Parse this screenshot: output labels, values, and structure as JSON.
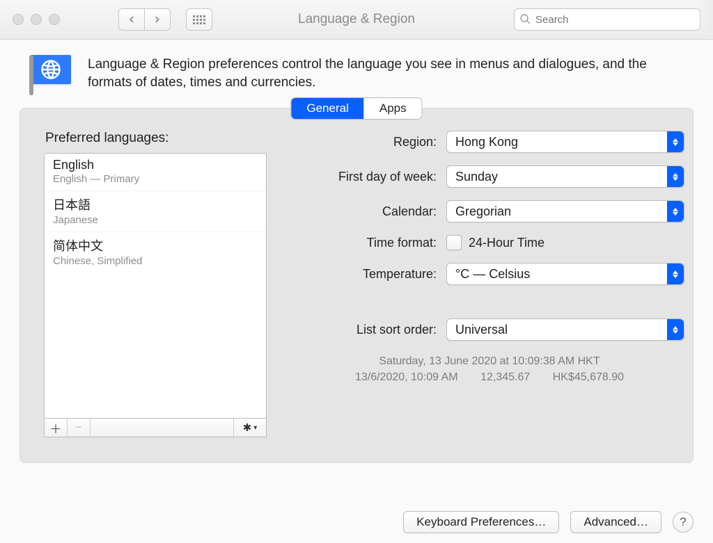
{
  "window": {
    "title": "Language & Region"
  },
  "toolbar": {
    "search_placeholder": "Search"
  },
  "intro": "Language & Region preferences control the language you see in menus and dialogues, and the formats of dates, times and currencies.",
  "tabs": {
    "general": "General",
    "apps": "Apps"
  },
  "left": {
    "heading": "Preferred languages:",
    "languages": [
      {
        "native": "English",
        "sub": "English — Primary"
      },
      {
        "native": "日本語",
        "sub": "Japanese"
      },
      {
        "native": "简体中文",
        "sub": "Chinese, Simplified"
      }
    ]
  },
  "right": {
    "region_label": "Region:",
    "region_value": "Hong Kong",
    "firstday_label": "First day of week:",
    "firstday_value": "Sunday",
    "calendar_label": "Calendar:",
    "calendar_value": "Gregorian",
    "timeformat_label": "Time format:",
    "timeformat_option": "24-Hour Time",
    "temperature_label": "Temperature:",
    "temperature_value": "°C — Celsius",
    "listsort_label": "List sort order:",
    "listsort_value": "Universal"
  },
  "example": {
    "line1": "Saturday, 13 June 2020 at 10:09:38 AM HKT",
    "short_dt": "13/6/2020, 10:09 AM",
    "number": "12,345.67",
    "currency": "HK$45,678.90"
  },
  "buttons": {
    "keyboard": "Keyboard Preferences…",
    "advanced": "Advanced…",
    "help": "?"
  }
}
